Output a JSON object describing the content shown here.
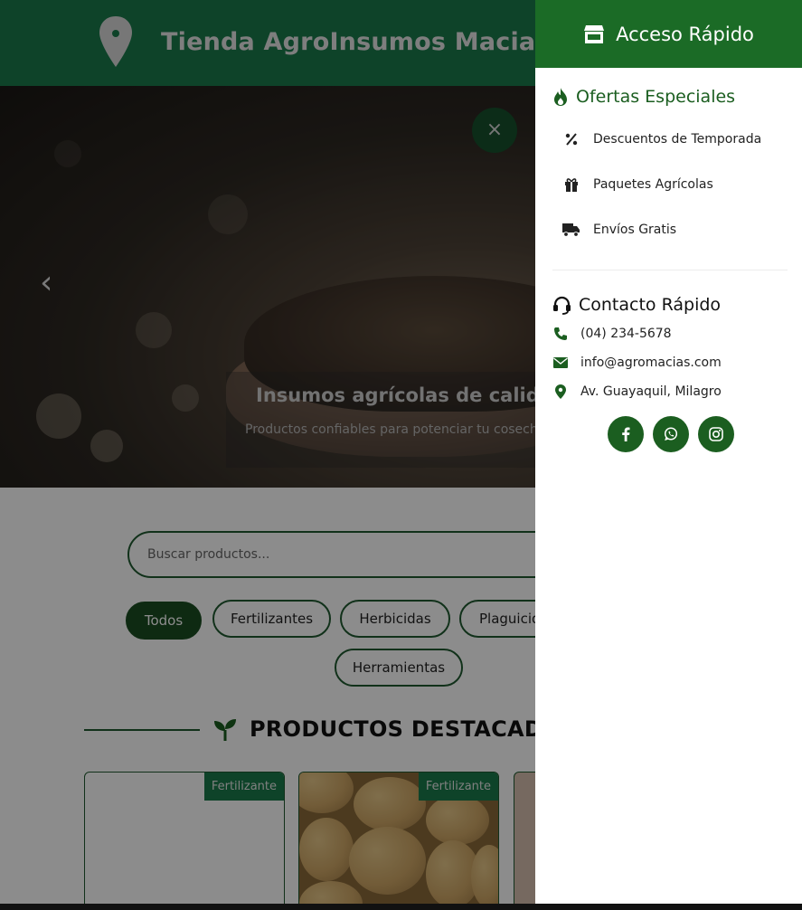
{
  "header": {
    "title": "Tienda AgroInsumos Macias",
    "logo_icon": "map-pin-icon"
  },
  "hero": {
    "title": "Insumos agrícolas de calidad",
    "subtitle": "Productos confiables para potenciar tu cosecha",
    "close_label": "×",
    "prev_label": "‹"
  },
  "search": {
    "placeholder": "Buscar productos..."
  },
  "filters": [
    "Todos",
    "Fertilizantes",
    "Herbicidas",
    "Plaguicidas",
    "Herramientas"
  ],
  "active_filter": "Todos",
  "section": {
    "title": "PRODUCTOS DESTACADOS",
    "icon": "sprout-icon"
  },
  "products": [
    {
      "badge": "Fertilizante"
    },
    {
      "badge": "Fertilizante"
    }
  ],
  "panel": {
    "title": "Acceso Rápido",
    "title_icon": "store-icon",
    "offers": {
      "title": "Ofertas Especiales",
      "icon": "fire-icon",
      "items": [
        {
          "label": "Descuentos de Temporada",
          "icon": "percent-icon"
        },
        {
          "label": "Paquetes Agrícolas",
          "icon": "gift-icon"
        },
        {
          "label": "Envíos Gratis",
          "icon": "truck-icon"
        }
      ]
    },
    "contact": {
      "title": "Contacto Rápido",
      "icon": "headset-icon",
      "items": [
        {
          "label": "(04) 234-5678",
          "icon": "phone-icon"
        },
        {
          "label": "info@agromacias.com",
          "icon": "envelope-icon"
        },
        {
          "label": "Av. Guayaquil, Milagro",
          "icon": "location-icon"
        }
      ]
    },
    "social": [
      "facebook-icon",
      "whatsapp-icon",
      "instagram-icon"
    ]
  },
  "colors": {
    "brand_green": "#1a7a4c",
    "panel_header": "#1b6b26",
    "accent_dark_green": "#1b5e20"
  }
}
